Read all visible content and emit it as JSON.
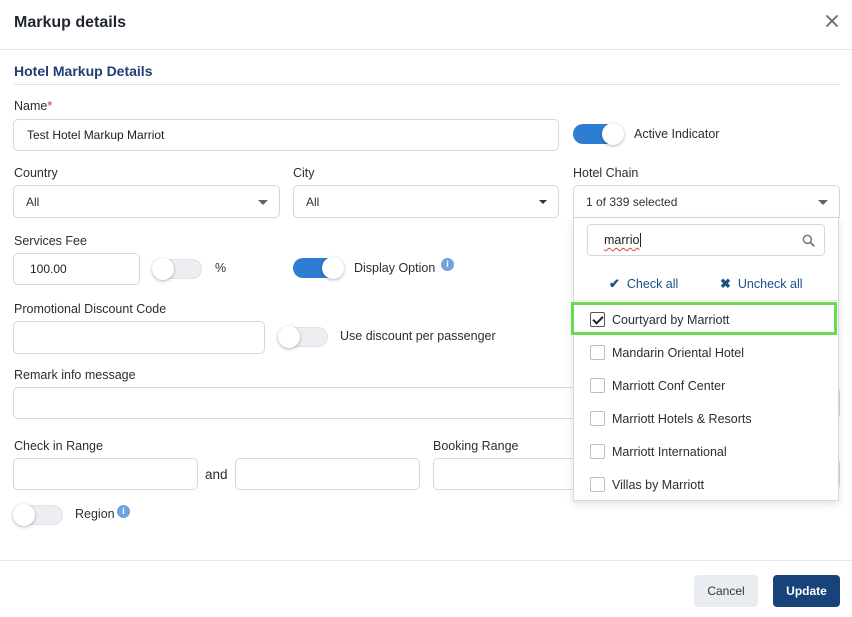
{
  "header": {
    "title": "Markup details"
  },
  "section": {
    "title": "Hotel Markup Details"
  },
  "name": {
    "label": "Name",
    "required_mark": "*",
    "value": "Test Hotel Markup Marriot"
  },
  "active_indicator": {
    "label": "Active Indicator",
    "on": true
  },
  "country": {
    "label": "Country",
    "value": "All"
  },
  "city": {
    "label": "City",
    "value": "All"
  },
  "hotel_chain": {
    "label": "Hotel Chain",
    "value": "1 of 339 selected",
    "search_value": "marrio",
    "check_all": "Check all",
    "uncheck_all": "Uncheck all",
    "options": [
      {
        "label": "Courtyard by Marriott",
        "checked": true
      },
      {
        "label": "Mandarin Oriental Hotel",
        "checked": false
      },
      {
        "label": "Marriott Conf Center",
        "checked": false
      },
      {
        "label": "Marriott Hotels & Resorts",
        "checked": false
      },
      {
        "label": "Marriott International",
        "checked": false
      },
      {
        "label": "Villas by Marriott",
        "checked": false
      }
    ]
  },
  "services_fee": {
    "label": "Services Fee",
    "value": "100.00",
    "percent_label": "%",
    "percent_on": false
  },
  "display_option": {
    "label": "Display Option",
    "on": true
  },
  "promo": {
    "label": "Promotional Discount Code",
    "value": ""
  },
  "discount_per_passenger": {
    "label": "Use discount per passenger",
    "on": false
  },
  "remark": {
    "label": "Remark info message",
    "value": ""
  },
  "check_in_range": {
    "label": "Check in Range",
    "and_label": "and"
  },
  "booking_range": {
    "label": "Booking Range"
  },
  "region": {
    "label": "Region",
    "on": false
  },
  "footer": {
    "cancel": "Cancel",
    "update": "Update"
  },
  "colors": {
    "accent": "#2d7dd2",
    "primary_button": "#17437a",
    "section_title": "#1d3f73",
    "highlight": "#6adb4c"
  }
}
